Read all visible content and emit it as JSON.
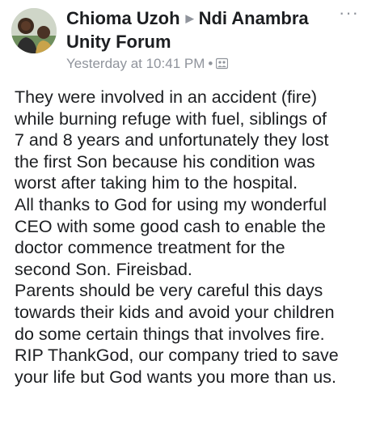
{
  "post": {
    "author": "Chioma Uzoh",
    "group": "Ndi Anambra Unity Forum",
    "timestamp": "Yesterday at 10:41 PM",
    "separator": "•",
    "audience_icon": "group-audience-icon",
    "more_icon": "more-options-icon",
    "lines": [
      "They were involved in an accident  (fire)",
      "while burning refuge with fuel, siblings of",
      "7 and 8 years and unfortunately they lost",
      "the first Son because his condition was",
      "worst after taking him to the hospital.",
      "All thanks to God for using my wonderful",
      "CEO with some good cash  to enable the",
      "doctor commence treatment for the",
      "second Son. Fireisbad.",
      "Parents should be very careful this days",
      "towards their kids and avoid your children",
      "do some certain things that involves fire.",
      "RIP ThankGod, our company tried to save",
      "your life but God wants you more than us."
    ]
  },
  "colors": {
    "text": "#1c1e21",
    "meta": "#90949c",
    "background": "#ffffff"
  }
}
